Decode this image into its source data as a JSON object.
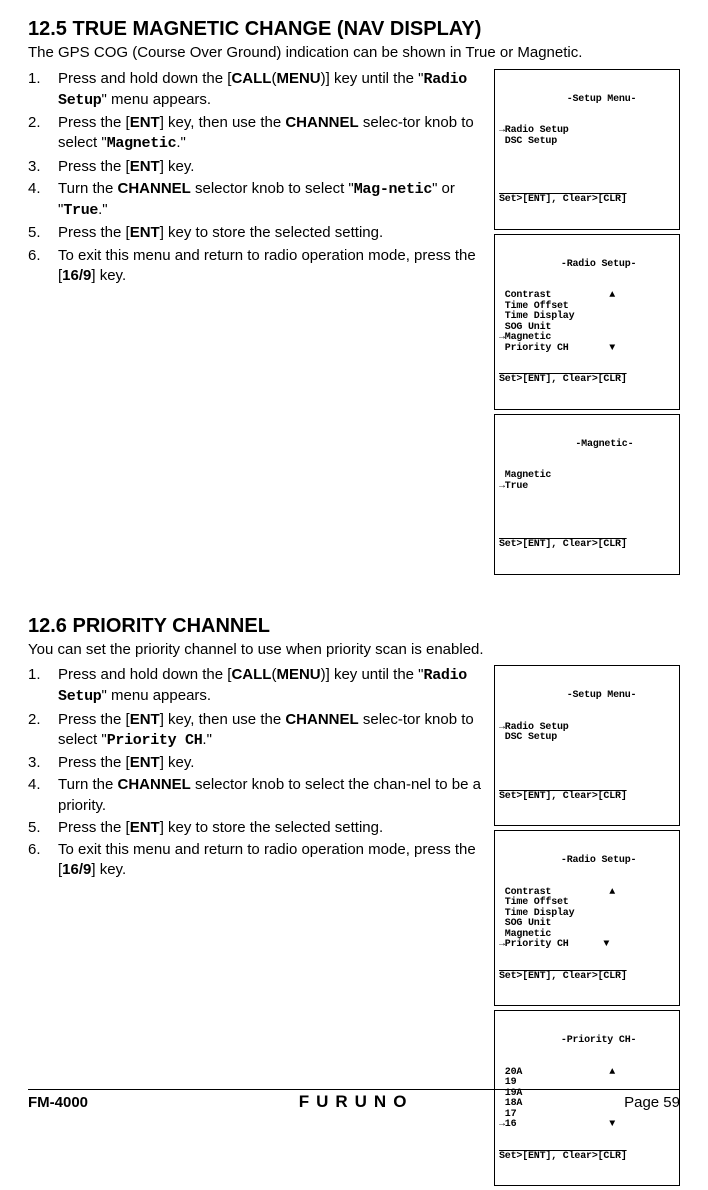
{
  "section_a": {
    "heading": "12.5   TRUE MAGNETIC CHANGE (NAV DISPLAY)",
    "intro": "The GPS COG (Course Over Ground) indication can be shown in True or Magnetic.",
    "steps": [
      {
        "pre": "Press and hold down the [",
        "k1": "CALL",
        "mid": "(",
        "k2": "MENU",
        "post": ")] key until the \"",
        "pix": "Radio Setup",
        "post2": "\" menu appears."
      },
      {
        "pre": "Press the [",
        "k1": "ENT",
        "mid": "] key, then use the ",
        "k2": "CHANNEL",
        "post": " selec-tor knob to select \"",
        "pix": "Magnetic",
        "post2": ".\""
      },
      {
        "pre": "Press the [",
        "k1": "ENT",
        "post": "] key."
      },
      {
        "pre": "Turn the ",
        "k1": "CHANNEL",
        "post": " selector knob to select \"",
        "pix": "Mag-netic",
        "mid2": "\" or \"",
        "pix2": "True",
        "post2": ".\""
      },
      {
        "pre": "Press the [",
        "k1": "ENT",
        "post": "] key to store the selected setting."
      },
      {
        "pre": "To exit this menu and return to radio operation mode, press the [",
        "k1": "16/9",
        "post": "] key."
      }
    ],
    "screens": [
      {
        "title": "     -Setup Menu-",
        "body": "→Radio Setup\n DSC Setup\n",
        "footer": "Set>[ENT], Clear>[CLR]"
      },
      {
        "title": "    -Radio Setup-",
        "body": " Contrast          ▲\n Time Offset\n Time Display\n SOG Unit\n→Magnetic\n Priority CH       ▼",
        "footer": "Set>[ENT], Clear>[CLR]"
      },
      {
        "title": "      -Magnetic-",
        "body": " Magnetic\n→True\n",
        "footer": "Set>[ENT], Clear>[CLR]"
      }
    ]
  },
  "section_b": {
    "heading": "12.6   PRIORITY CHANNEL",
    "intro": "You can set the priority channel to use when priority scan is enabled.",
    "steps": [
      {
        "pre": "Press and hold down the [",
        "k1": "CALL",
        "mid": "(",
        "k2": "MENU",
        "post": ")] key until the \"",
        "pix": "Radio Setup",
        "post2": "\" menu appears."
      },
      {
        "pre": "Press the [",
        "k1": "ENT",
        "mid": "] key, then use the ",
        "k2": "CHANNEL",
        "post": " selec-tor knob to select \"",
        "pix": "Priority CH",
        "post2": ".\""
      },
      {
        "pre": "Press the [",
        "k1": "ENT",
        "post": "] key."
      },
      {
        "pre": "Turn the ",
        "k1": "CHANNEL",
        "post": " selector knob to select the chan-nel to be a priority."
      },
      {
        "pre": "Press the [",
        "k1": "ENT",
        "post": "] key to store the selected setting."
      },
      {
        "pre": "To exit this menu and return to radio operation mode, press the [",
        "k1": "16/9",
        "post": "] key."
      }
    ],
    "screens": [
      {
        "title": "     -Setup Menu-",
        "body": "→Radio Setup\n DSC Setup\n",
        "footer": "Set>[ENT], Clear>[CLR]"
      },
      {
        "title": "    -Radio Setup-",
        "body": " Contrast          ▲\n Time Offset\n Time Display\n SOG Unit\n Magnetic\n→Priority CH      ▼",
        "footer": "Set>[ENT], Clear>[CLR]"
      },
      {
        "title": "    -Priority CH-",
        "body": " 20A               ▲\n 19\n 19A\n 18A\n 17\n→16                ▼",
        "footer": "Set>[ENT], Clear>[CLR]"
      }
    ]
  },
  "footer": {
    "model": "FM-4000",
    "brand": "FURUNO",
    "page": "Page 59"
  }
}
